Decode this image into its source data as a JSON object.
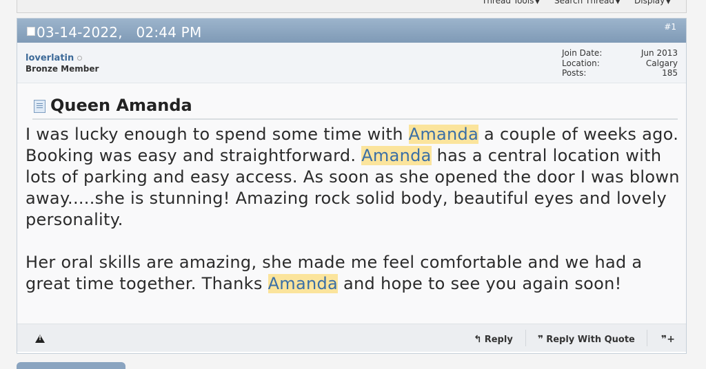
{
  "toolbar": {
    "thread_tools": "Thread Tools",
    "search_thread": "Search Thread",
    "display": "Display"
  },
  "post": {
    "date": "03-14-2022,",
    "time": "02:44 PM",
    "number": "#1",
    "user": {
      "name": "loverlatin",
      "title": "Bronze Member",
      "join_date_label": "Join Date:",
      "join_date": "Jun 2013",
      "location_label": "Location:",
      "location": "Calgary",
      "posts_label": "Posts:",
      "posts": "185"
    },
    "title": "Queen Amanda",
    "highlight_term": "Amanda",
    "body": {
      "p1_a": "I was lucky enough to spend some time with ",
      "p1_b": " a couple of weeks ago. Booking was easy and straightforward. ",
      "p1_c": " has a central location with lots of parking and easy access. As soon as she opened the door I was blown away.....she is stunning! Amazing rock solid body, beautiful eyes and lovely personality.",
      "p2_a": "Her oral skills are amazing, she made me feel comfortable and we had a great time together. Thanks ",
      "p2_b": " and hope to see you again soon!"
    },
    "footer": {
      "reply": "Reply",
      "reply_with_quote": "Reply With Quote"
    }
  },
  "colors": {
    "header_bar": "#8aa4c0",
    "username": "#3d6a98",
    "highlight_bg": "#fbe49c",
    "highlight_text": "#3b6fa6"
  },
  "icons": [
    "post-status-icon",
    "offline-status-icon",
    "document-icon",
    "report-post-icon",
    "reply-icon",
    "quote-bubble-icon",
    "multi-quote-icon",
    "caret-down-icon"
  ]
}
